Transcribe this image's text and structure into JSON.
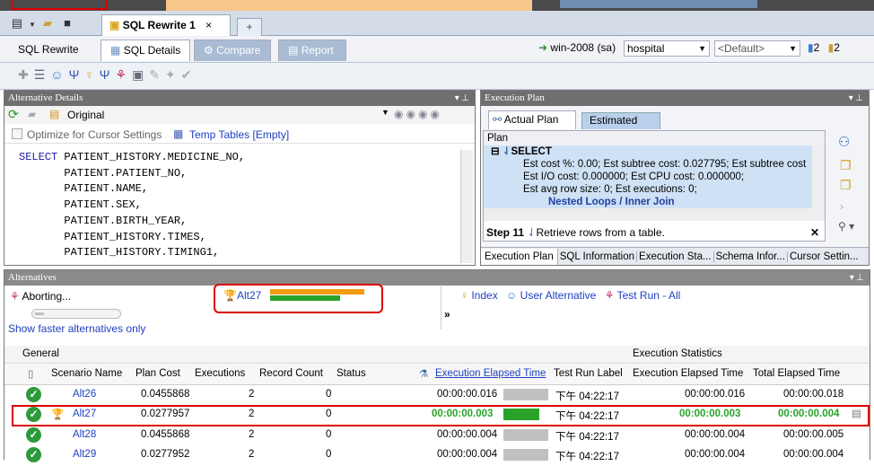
{
  "doc_tab": {
    "title": "SQL Rewrite 1",
    "close": "×",
    "plus": "+"
  },
  "subtabs": [
    {
      "label": "SQL Rewrite"
    },
    {
      "label": "SQL Details"
    },
    {
      "label": "Compare"
    },
    {
      "label": "Report"
    }
  ],
  "connection": {
    "server": "win-2008 (sa)",
    "database": "hospital",
    "default": "<Default>",
    "count1": "2",
    "count2": "2"
  },
  "alt_details": {
    "title": "Alternative Details",
    "original": "Original",
    "optimize": "Optimize for Cursor",
    "settings": "Settings",
    "temp_tables": "Temp Tables [Empty]",
    "sql": [
      "SELECT PATIENT_HISTORY.MEDICINE_NO,",
      "       PATIENT.PATIENT_NO,",
      "       PATIENT.NAME,",
      "       PATIENT.SEX,",
      "       PATIENT.BIRTH_YEAR,",
      "       PATIENT_HISTORY.TIMES,",
      "       PATIENT_HISTORY.TIMING1,"
    ]
  },
  "exec_plan": {
    "title": "Execution Plan",
    "tab_actual": "Actual Plan",
    "tab_estimated": "Estimated Plan",
    "plan_label": "Plan",
    "node": "SELECT",
    "line1": "Est cost %: 0.00; Est subtree cost: 0.027795; Est subtree cost",
    "line2": "Est I/O cost: 0.000000; Est CPU cost: 0.000000;",
    "line3": "Est avg row size: 0; Est executions: 0;",
    "line4": "Nested Loops / Inner Join",
    "step_label": "Step 11",
    "step_text": "Retrieve rows from a table.",
    "bottom_tabs": [
      "Execution Plan",
      "SQL Information",
      "Execution Sta...",
      "Schema Infor...",
      "Cursor Settin..."
    ]
  },
  "alternatives": {
    "title": "Alternatives",
    "aborting": "Aborting...",
    "show_faster": "Show faster alternatives only",
    "best": "Alt27",
    "index": "Index",
    "user_alt": "User Alternative",
    "test_run": "Test Run - All",
    "more": "»"
  },
  "grid": {
    "group_general": "General",
    "group_stats": "Execution Statistics",
    "headers": [
      "Scenario Name",
      "Plan Cost",
      "Executions",
      "Record Count",
      "Status",
      "Execution Elapsed Time",
      "Test Run Label",
      "Execution Elapsed Time",
      "Total Elapsed Time"
    ],
    "rows": [
      {
        "name": "Alt26",
        "cost": "0.0455868",
        "exec": "2",
        "records": "0",
        "elapsed": "00:00:00.016",
        "label": "下午 04:22:17",
        "exec2": "00:00:00.016",
        "total": "00:00:00.018"
      },
      {
        "name": "Alt27",
        "cost": "0.0277957",
        "exec": "2",
        "records": "0",
        "elapsed": "00:00:00.003",
        "label": "下午 04:22:17",
        "exec2": "00:00:00.003",
        "total": "00:00:00.004"
      },
      {
        "name": "Alt28",
        "cost": "0.0455868",
        "exec": "2",
        "records": "0",
        "elapsed": "00:00:00.004",
        "label": "下午 04:22:17",
        "exec2": "00:00:00.004",
        "total": "00:00:00.005"
      },
      {
        "name": "Alt29",
        "cost": "0.0277952",
        "exec": "2",
        "records": "0",
        "elapsed": "00:00:00.004",
        "label": "下午 04:22:17",
        "exec2": "00:00:00.004",
        "total": "00:00:00.004"
      }
    ]
  },
  "colors": {
    "highlight_red": "#d00000",
    "green": "#2aa22a",
    "orange": "#f39c12"
  }
}
